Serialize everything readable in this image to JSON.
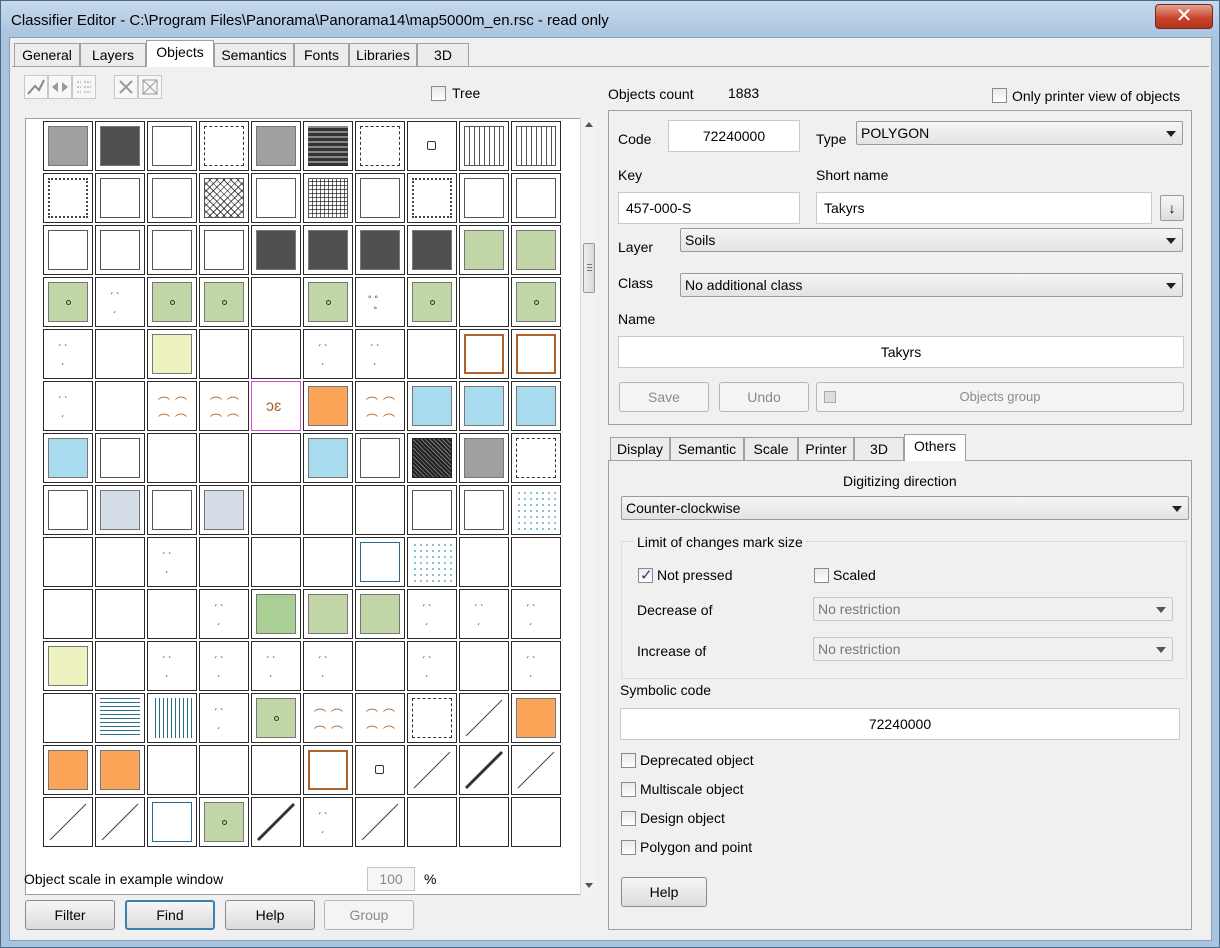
{
  "window": {
    "title": "Classifier Editor - C:\\Program Files\\Panorama\\Panorama14\\map5000m_en.rsc - read only",
    "close": "✕"
  },
  "tabs": [
    {
      "label": "General"
    },
    {
      "label": "Layers"
    },
    {
      "label": "Objects",
      "active": true
    },
    {
      "label": "Semantics"
    },
    {
      "label": "Fonts"
    },
    {
      "label": "Libraries"
    },
    {
      "label": "3D"
    }
  ],
  "left": {
    "tree_label": "Tree",
    "scale_label": "Object scale in example window",
    "scale_value": "100",
    "scale_unit": "%",
    "buttons": {
      "filter": "Filter",
      "find": "Find",
      "help": "Help",
      "group": "Group"
    }
  },
  "objects": {
    "count_label": "Objects count",
    "count_value": "1883",
    "printer_view_label": "Only printer view of objects",
    "code_label": "Code",
    "code_value": "72240000",
    "type_label": "Type",
    "type_value": "POLYGON",
    "key_label": "Key",
    "key_value": "457-000-S",
    "short_name_label": "Short name",
    "short_name_value": "Takyrs",
    "layer_label": "Layer",
    "layer_value": "Soils",
    "class_label": "Class",
    "class_value": "No additional class",
    "name_label": "Name",
    "name_value": "Takyrs",
    "save": "Save",
    "undo": "Undo",
    "objects_group": "Objects group"
  },
  "subtabs": [
    {
      "label": "Display"
    },
    {
      "label": "Semantic"
    },
    {
      "label": "Scale"
    },
    {
      "label": "Printer"
    },
    {
      "label": "3D"
    },
    {
      "label": "Others",
      "active": true
    }
  ],
  "others": {
    "digitizing_label": "Digitizing direction",
    "digitizing_value": "Counter-clockwise",
    "limit_group": "Limit of changes mark size",
    "not_pressed": "Not pressed",
    "scaled": "Scaled",
    "decrease_label": "Decrease of",
    "decrease_value": "No restriction",
    "increase_label": "Increase of",
    "increase_value": "No restriction",
    "symbolic_label": "Symbolic code",
    "symbolic_value": "72240000",
    "deprecated": "Deprecated object",
    "multiscale": "Multiscale object",
    "design": "Design object",
    "polygon_point": "Polygon and point",
    "help": "Help"
  },
  "palette": {
    "gray": "#a0a0a0",
    "dark": "#505050",
    "green": "#c2d6a8",
    "green2": "#a9cf94",
    "blue": "#a8dcee",
    "orange": "#fca559",
    "yellow": "#eef2c0",
    "slate": "#d5dde8",
    "brown": "#b0622a"
  },
  "symbols": [
    [
      "gray",
      "dark",
      "blank",
      "dashframe",
      "gray",
      "hlines",
      "dashframe",
      "dot",
      "vlines",
      "vlines"
    ],
    [
      "dotframe",
      "blank",
      "blank",
      "cross",
      "blank",
      "hatch",
      "blank",
      "dotframe",
      "blank",
      "blank"
    ],
    [
      "blank",
      "blank",
      "blank",
      "blank",
      "dark",
      "dark",
      "dark",
      "dark",
      "green",
      "green"
    ],
    [
      "green",
      "ticks",
      "green",
      "green",
      "empty",
      "green",
      "dots",
      "green",
      "empty",
      "green"
    ],
    [
      "ticks",
      "empty",
      "yellow",
      "empty",
      "empty",
      "ticks",
      "ticks",
      "empty",
      "brownframe",
      "brownframe"
    ],
    [
      "ticks",
      "empty",
      "brownsym",
      "brownsym",
      "pinkframe",
      "orange",
      "brownsym",
      "blue",
      "blue",
      "blue"
    ],
    [
      "blue",
      "blank",
      "empty",
      "empty",
      "empty",
      "blue",
      "blank",
      "hatchdark",
      "gray",
      "dashframe"
    ],
    [
      "blank",
      "slate",
      "blank",
      "slate",
      "empty",
      "empty",
      "empty",
      "blank",
      "blank",
      "dotgrid"
    ],
    [
      "empty",
      "empty",
      "ticks",
      "empty",
      "empty",
      "empty",
      "blueframe",
      "dotgrid",
      "empty",
      "empty"
    ],
    [
      "empty",
      "empty",
      "empty",
      "ticks",
      "green2",
      "green",
      "green",
      "ticks",
      "ticks",
      "ticks"
    ],
    [
      "yellow",
      "empty",
      "ticks",
      "ticks",
      "ticks",
      "ticks",
      "empty",
      "ticks",
      "empty",
      "ticks"
    ],
    [
      "empty",
      "bluelines",
      "bluevlines",
      "ticks",
      "green",
      "brownsym",
      "brownsym",
      "dashframe",
      "diag",
      "orange"
    ],
    [
      "orange",
      "orange",
      "empty",
      "empty",
      "empty",
      "brownframe",
      "dot",
      "diag",
      "diagbold",
      "diag"
    ],
    [
      "diag",
      "diag",
      "blueframe",
      "green",
      "diagbold",
      "ticks",
      "diag",
      "empty",
      "empty",
      "empty"
    ]
  ]
}
